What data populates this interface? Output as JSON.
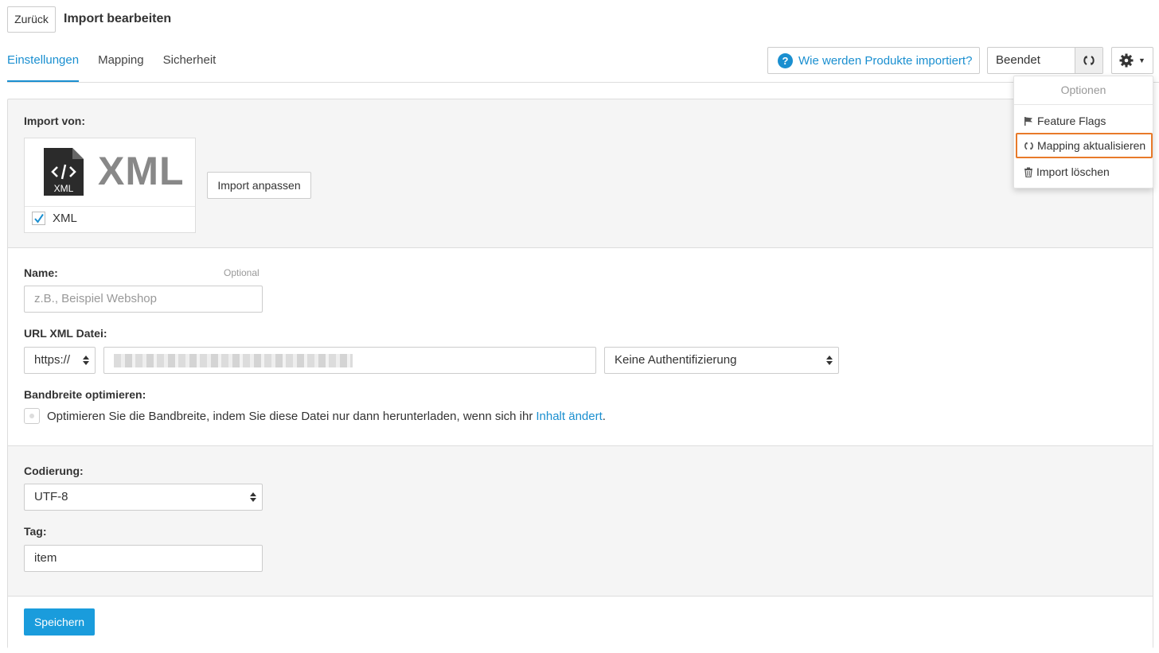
{
  "header": {
    "back_label": "Zurück",
    "title": "Import bearbeiten"
  },
  "tabs": [
    {
      "label": "Einstellungen",
      "active": true
    },
    {
      "label": "Mapping",
      "active": false
    },
    {
      "label": "Sicherheit",
      "active": false
    }
  ],
  "toolbar": {
    "help_icon": "?",
    "help_label": "Wie werden Produkte importiert?",
    "status_value": "Beendet"
  },
  "dropdown": {
    "header": "Optionen",
    "items": [
      {
        "label": "Feature Flags",
        "icon": "flag-icon"
      },
      {
        "label": "Mapping aktualisieren",
        "icon": "refresh-icon",
        "highlighted": true
      },
      {
        "label": "Import löschen",
        "icon": "trash-icon"
      }
    ]
  },
  "import_source": {
    "label": "Import von:",
    "logo_text": "XML",
    "file_icon_text": "XML",
    "checkbox_label": "XML",
    "checked": true,
    "customize_label": "Import anpassen"
  },
  "form": {
    "name_label": "Name:",
    "name_optional": "Optional",
    "name_placeholder": "z.B., Beispiel Webshop",
    "url_label": "URL XML Datei:",
    "protocol_value": "https://",
    "auth_value": "Keine Authentifizierung",
    "bandwidth_label": "Bandbreite optimieren:",
    "bandwidth_text": "Optimieren Sie die Bandbreite, indem Sie diese Datei nur dann herunterladen, wenn sich ihr",
    "bandwidth_link": "Inhalt ändert",
    "bandwidth_end": ".",
    "encoding_label": "Codierung:",
    "encoding_value": "UTF-8",
    "tag_label": "Tag:",
    "tag_value": "item"
  },
  "footer": {
    "save_label": "Speichern"
  },
  "colors": {
    "accent": "#1a8fd0",
    "highlight_border": "#e87a2a",
    "save_button": "#1a9cdc"
  }
}
